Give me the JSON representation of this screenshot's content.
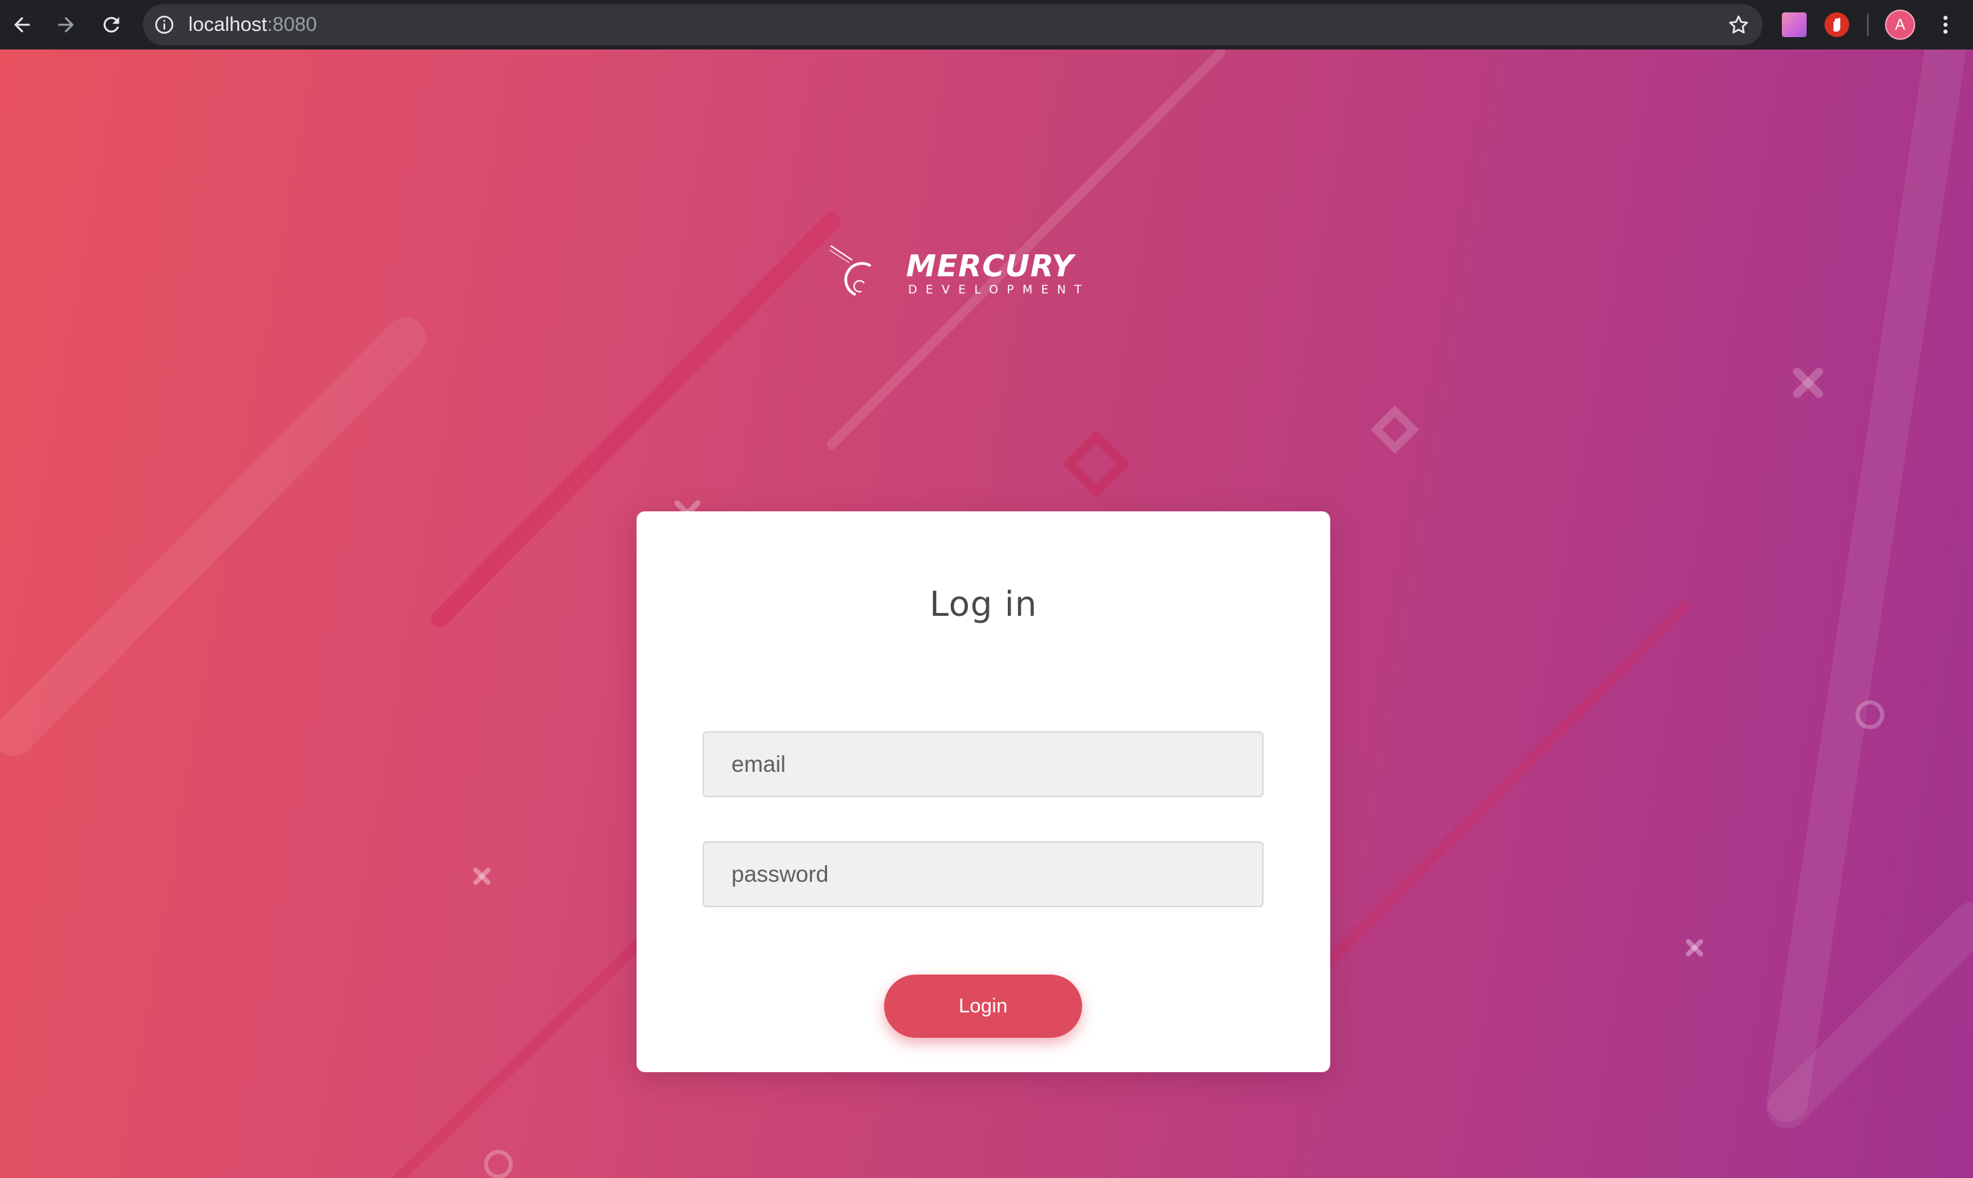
{
  "browser": {
    "url_host": "localhost",
    "url_port": ":8080",
    "profile_initial": "A",
    "icons": {
      "back": "back-arrow-icon",
      "forward": "forward-arrow-icon",
      "reload": "reload-icon",
      "site_info": "info-icon",
      "bookmark": "star-icon",
      "menu": "kebab-menu-icon"
    }
  },
  "logo": {
    "wordmark": "MERCURY",
    "tagline": "DEVELOPMENT"
  },
  "login": {
    "title": "Log in",
    "email_placeholder": "email",
    "password_placeholder": "password",
    "submit_label": "Login"
  },
  "colors": {
    "gradient_start": "#e8525f",
    "gradient_end": "#a0338f",
    "button": "#de4b5c",
    "chrome": "#202124"
  }
}
